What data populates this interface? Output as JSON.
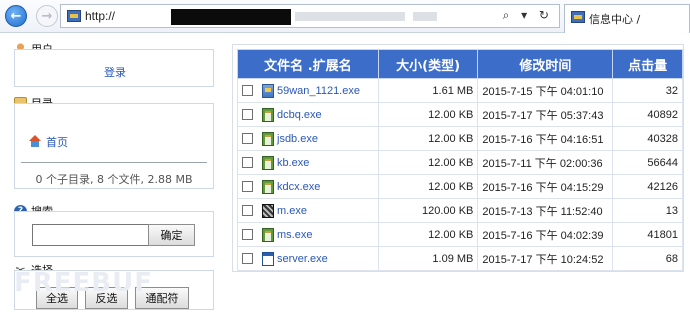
{
  "browser": {
    "address_text": "http://",
    "address_tools": "⌕ ▾ ↻",
    "tab_title": "信息中心 /"
  },
  "sidebar": {
    "user": {
      "title": "用户",
      "login_link": "登录"
    },
    "directory": {
      "title": "目录",
      "home_link": "首页",
      "summary": "0 个子目录, 8 个文件, 2.88 MB"
    },
    "search": {
      "title": "搜索",
      "input_value": "",
      "confirm_button": "确定"
    },
    "select": {
      "title": "选择",
      "select_all": "全选",
      "invert": "反选",
      "wildcard": "通配符"
    }
  },
  "file_table": {
    "headers": {
      "name": "文件名 .扩展名",
      "size": "大小(类型)",
      "mtime": "修改时间",
      "clicks": "点击量"
    },
    "rows": [
      {
        "icon": "installer-icon",
        "name": "59wan_1121.exe",
        "size": "1.61 MB",
        "mtime": "2015-7-15 下午 04:01:10",
        "clicks": "32"
      },
      {
        "icon": "clipboard-exe-icon",
        "name": "dcbq.exe",
        "size": "12.00 KB",
        "mtime": "2015-7-17 下午 05:37:43",
        "clicks": "40892"
      },
      {
        "icon": "clipboard-exe-icon",
        "name": "jsdb.exe",
        "size": "12.00 KB",
        "mtime": "2015-7-16 下午 04:16:51",
        "clicks": "40328"
      },
      {
        "icon": "clipboard-exe-icon",
        "name": "kb.exe",
        "size": "12.00 KB",
        "mtime": "2015-7-11 下午 02:00:36",
        "clicks": "56644"
      },
      {
        "icon": "clipboard-exe-icon",
        "name": "kdcx.exe",
        "size": "12.00 KB",
        "mtime": "2015-7-16 下午 04:15:29",
        "clicks": "42126"
      },
      {
        "icon": "pattern-exe-icon",
        "name": "m.exe",
        "size": "120.00 KB",
        "mtime": "2015-7-13 下午 11:52:40",
        "clicks": "13"
      },
      {
        "icon": "clipboard-exe-icon",
        "name": "ms.exe",
        "size": "12.00 KB",
        "mtime": "2015-7-16 下午 04:02:39",
        "clicks": "41801"
      },
      {
        "icon": "window-exe-icon",
        "name": "server.exe",
        "size": "1.09 MB",
        "mtime": "2015-7-17 下午 10:24:52",
        "clicks": "68"
      }
    ]
  },
  "watermark": "FREEBUF"
}
